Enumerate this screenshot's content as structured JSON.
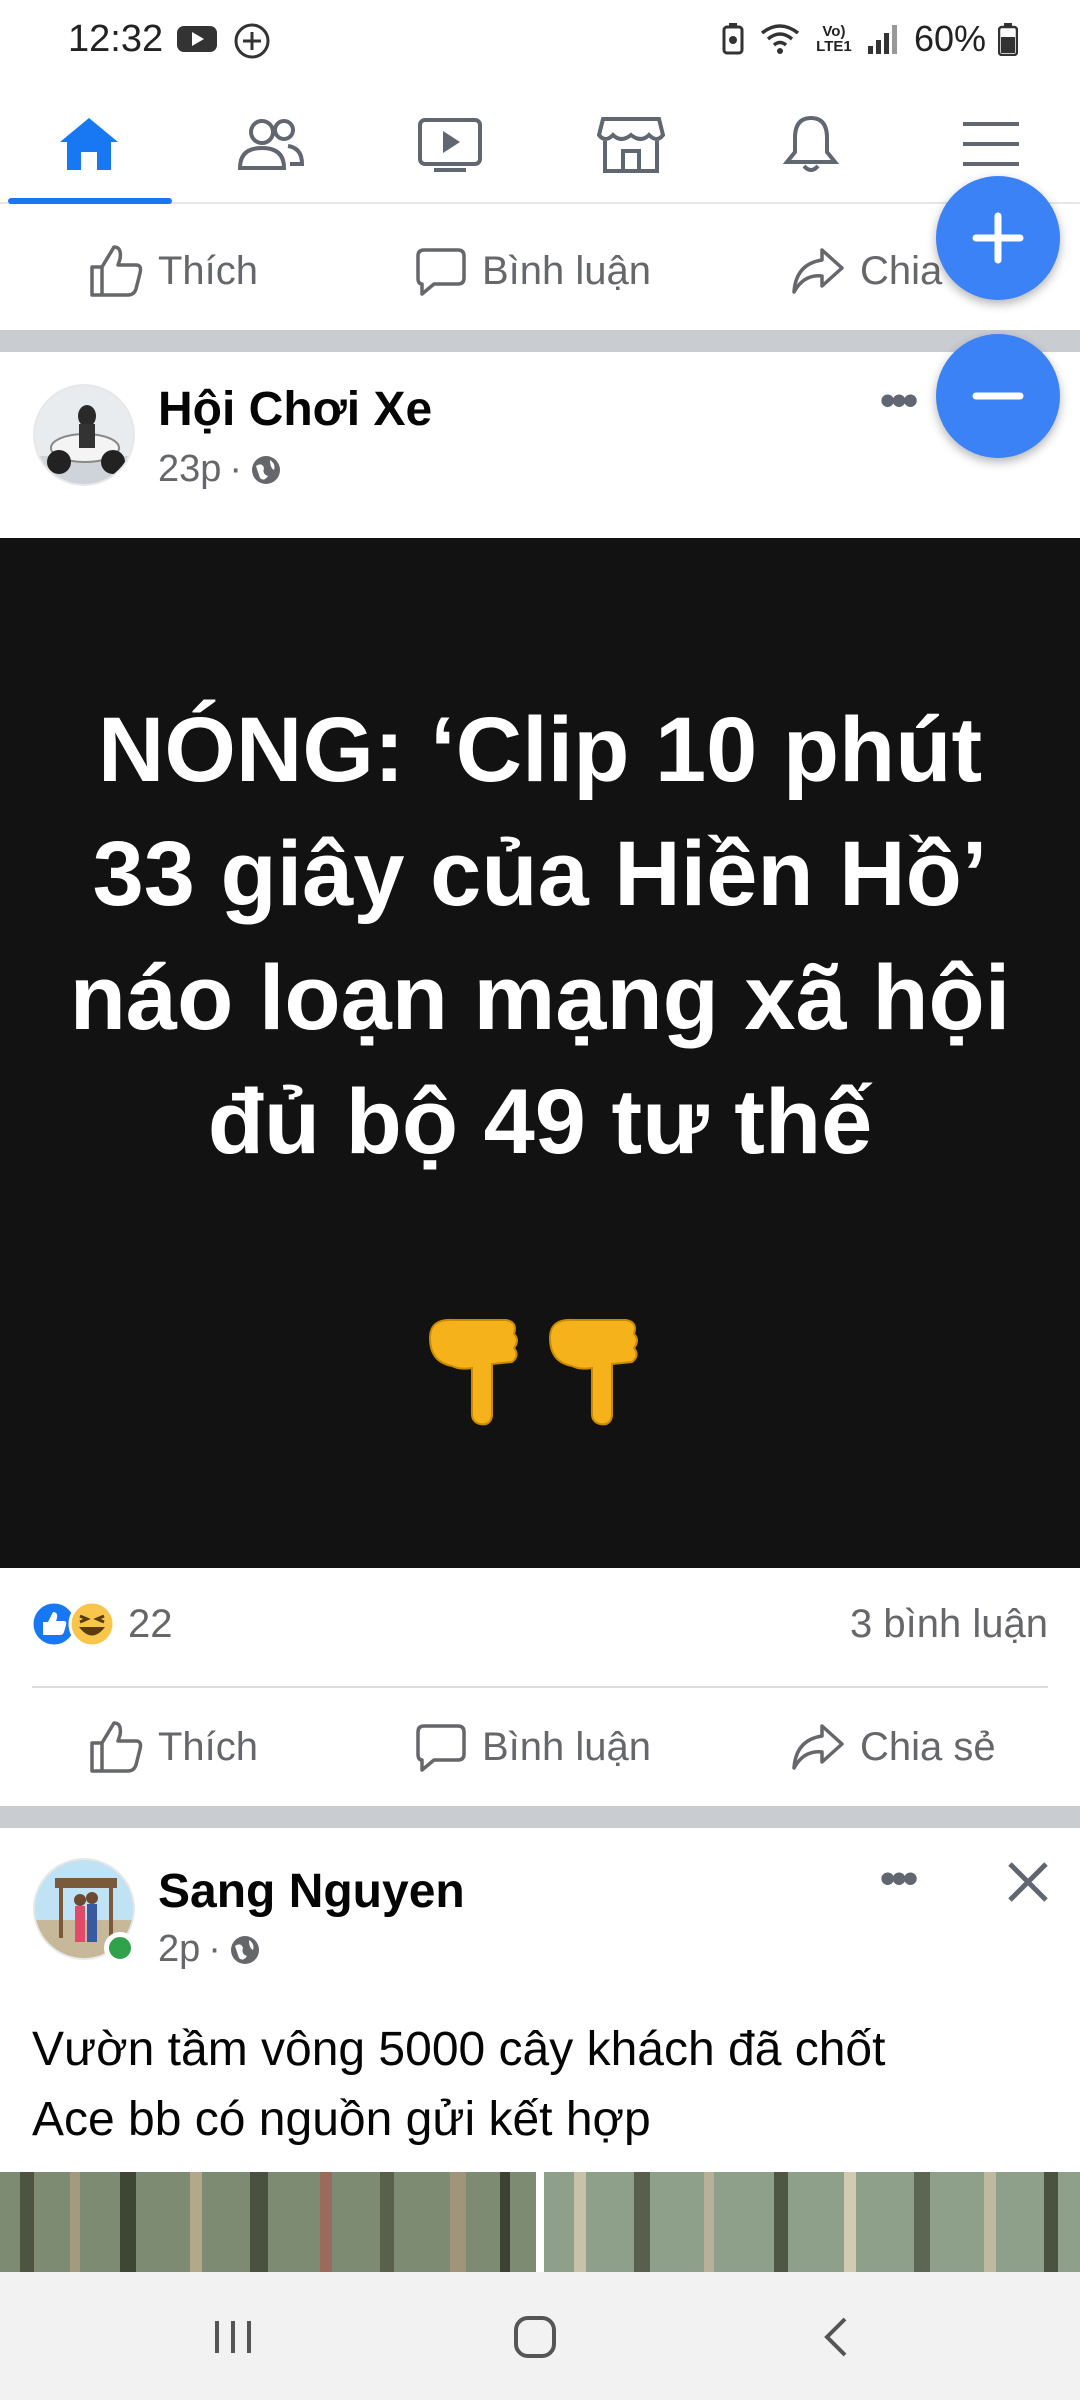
{
  "status_bar": {
    "time": "12:32",
    "battery": "60%",
    "network_label": "Vo) LTE1",
    "icons": [
      "youtube-icon",
      "add-circle-icon",
      "battery-saver-icon",
      "wifi-icon",
      "signal-icon",
      "battery-icon"
    ]
  },
  "nav": {
    "items": [
      {
        "name": "home",
        "icon": "home-icon",
        "active": true
      },
      {
        "name": "friends",
        "icon": "friends-icon"
      },
      {
        "name": "watch",
        "icon": "video-icon"
      },
      {
        "name": "marketplace",
        "icon": "store-icon"
      },
      {
        "name": "notifications",
        "icon": "bell-icon"
      },
      {
        "name": "menu",
        "icon": "menu-icon"
      }
    ],
    "accent": "#1877f2"
  },
  "actions": {
    "like": "Thích",
    "comment": "Bình luận",
    "share": "Chia sẻ"
  },
  "post1": {
    "author": "Hội Chơi Xe",
    "time": "23p",
    "image_text": "NÓNG: ‘Clip 10 phút 33 giây của Hiền Hồ’ náo loạn mạng xã hội đủ bộ 49 tư thế",
    "image_emoji": "👇👇",
    "reaction_count": "22",
    "comment_count": "3 bình luận"
  },
  "post2": {
    "author": "Sang Nguyen",
    "time": "2p",
    "text_line1": "Vườn tầm vông 5000 cây khách đã chốt",
    "text_line2": "Ace bb có nguồn gửi kết hợp"
  },
  "fab": {
    "zoom_in": "+",
    "zoom_out": "−",
    "color": "#3b82f6"
  }
}
